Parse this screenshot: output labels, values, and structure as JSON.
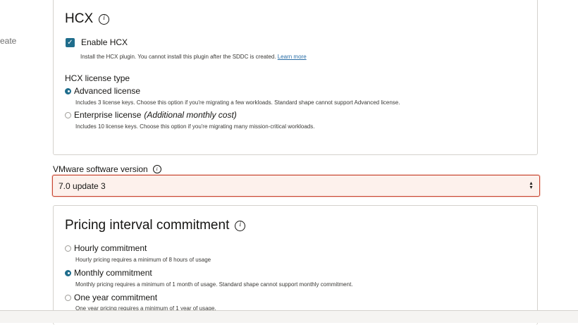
{
  "left_fragment": "eate",
  "hcx": {
    "title": "HCX",
    "enable_label": "Enable HCX",
    "enable_help": "Install the HCX plugin. You cannot install this plugin after the SDDC is created.",
    "learn_more": "Learn more",
    "license_heading": "HCX license type",
    "options": [
      {
        "label": "Advanced license",
        "suffix": "",
        "help": "Includes 3 license keys. Choose this option if you're migrating a few workloads. Standard shape cannot support Advanced license.",
        "selected": true
      },
      {
        "label": "Enterprise license",
        "suffix": "(Additional monthly cost)",
        "help": "Includes 10 license keys. Choose this option if you're migrating many mission-critical workloads.",
        "selected": false
      }
    ]
  },
  "vmware": {
    "label": "VMware software version",
    "value": "7.0 update 3"
  },
  "pricing": {
    "title": "Pricing interval commitment",
    "options": [
      {
        "label": "Hourly commitment",
        "help": "Hourly pricing requires a minimum of 8 hours of usage",
        "selected": false
      },
      {
        "label": "Monthly commitment",
        "help": "Monthly pricing requires a minimum of 1 month of usage. Standard shape cannot support monthly commitment.",
        "selected": true
      },
      {
        "label": "One year commitment",
        "help": "One year pricing requires a minimum of 1 year of usage.",
        "selected": false
      }
    ]
  },
  "colors": {
    "accent": "#1f6d8c",
    "focus_border": "#c74634",
    "focus_bg": "#fdf1ec"
  }
}
